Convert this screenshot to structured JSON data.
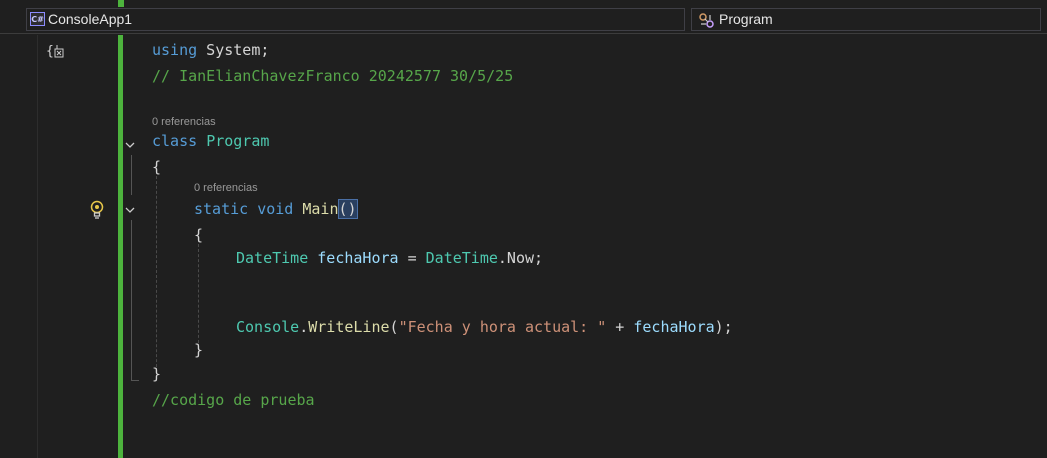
{
  "navbar": {
    "project_badge": "C#",
    "project_name": "ConsoleApp1",
    "member_name": "Program"
  },
  "code": {
    "line1_kw": "using",
    "line1_rest": " System;",
    "line2_comment": "// IanElianChavezFranco 20242577 30/5/25",
    "lens1": "0 referencias",
    "line3_kw": "class",
    "line3_name": "Program",
    "line4": "{",
    "lens2": "0 referencias",
    "line5_kw1": "static",
    "line5_kw2": "void",
    "line5_fn": "Main",
    "line5_paren": "()",
    "line6": "{",
    "line7_type1": "DateTime",
    "line7_var": "fechaHora",
    "line7_eq": " = ",
    "line7_type2": "DateTime",
    "line7_rest": ".Now;",
    "line8_type": "Console",
    "line8_dot": ".",
    "line8_fn": "WriteLine",
    "line8_open": "(",
    "line8_str": "\"Fecha y hora actual: \"",
    "line8_plus": " + ",
    "line8_var": "fechaHora",
    "line8_close": ");",
    "line9": "}",
    "line10": "}",
    "line11_comment": "//codigo de prueba"
  },
  "icons": {
    "scope": "{",
    "lightbulb": "lightbulb-icon",
    "class_icon": "class-icon"
  },
  "colors": {
    "change_bar": "#4db33d",
    "keyword": "#569cd6",
    "type": "#4ec9b0",
    "comment": "#57a64a",
    "string": "#ce9178",
    "method": "#dcdcaa",
    "variable": "#9cdcfe"
  }
}
